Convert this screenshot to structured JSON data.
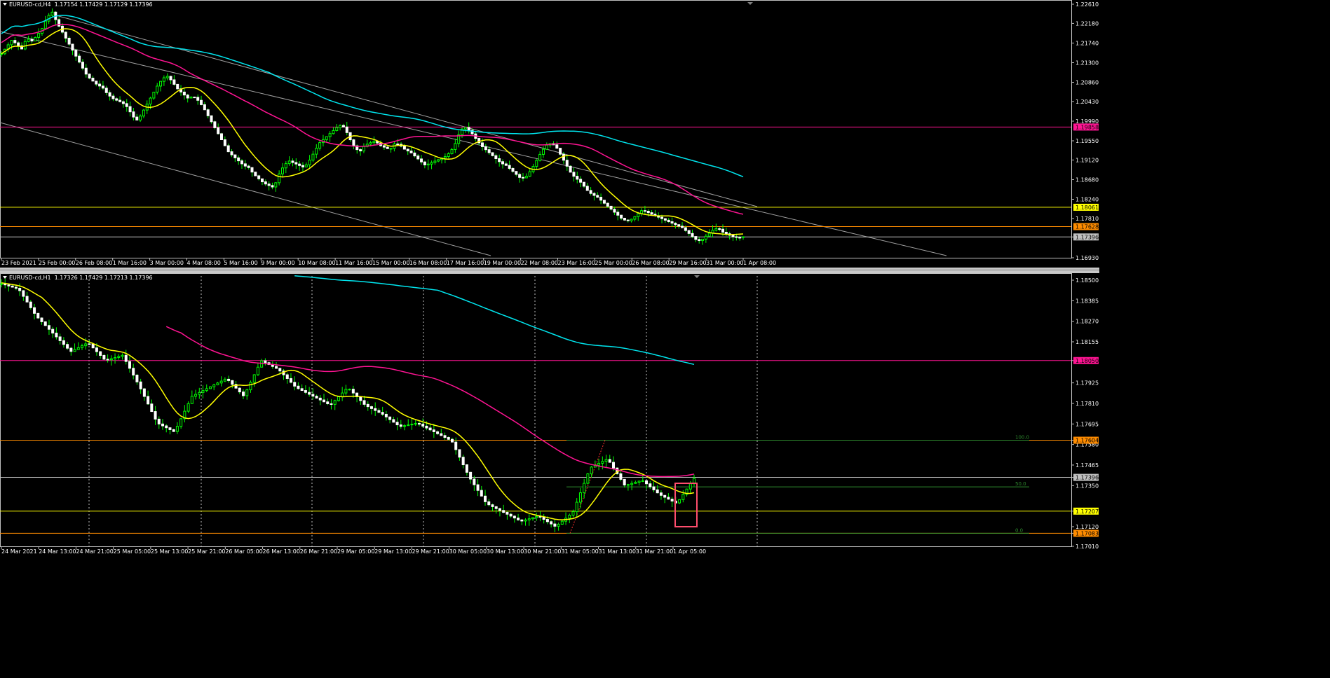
{
  "panes": [
    {
      "id": "h4",
      "title": {
        "symbol": "EURUSD-cd,H4",
        "ohlc": "1.17154 1.17429 1.17129 1.17396"
      },
      "chart_data": {
        "type": "candlestick",
        "timeframe": "H4",
        "ylim": [
          1.1693,
          1.2261
        ],
        "y_ticks": [
          "1.22610",
          "1.22180",
          "1.21740",
          "1.21300",
          "1.20860",
          "1.20430",
          "1.19990",
          "1.19550",
          "1.19120",
          "1.18680",
          "1.18240",
          "1.17810",
          "1.17396",
          "1.16930"
        ],
        "x_labels": [
          "23 Feb 2021",
          "25 Feb 00:00",
          "26 Feb 08:00",
          "1 Mar 16:00",
          "3 Mar 00:00",
          "4 Mar 08:00",
          "5 Mar 16:00",
          "9 Mar 00:00",
          "10 Mar 08:00",
          "11 Mar 16:00",
          "15 Mar 00:00",
          "16 Mar 08:00",
          "17 Mar 16:00",
          "19 Mar 00:00",
          "22 Mar 08:00",
          "23 Mar 16:00",
          "25 Mar 00:00",
          "26 Mar 08:00",
          "29 Mar 16:00",
          "31 Mar 00:00",
          "1 Apr 08:00"
        ],
        "n_bars": 220,
        "closes": [
          1.215,
          1.2165,
          1.218,
          1.2172,
          1.216,
          1.2185,
          1.2178,
          1.219,
          1.2205,
          1.223,
          1.2245,
          1.222,
          1.22,
          1.218,
          1.216,
          1.214,
          1.212,
          1.21,
          1.209,
          1.208,
          1.2075,
          1.206,
          1.205,
          1.2045,
          1.204,
          1.203,
          1.201,
          1.2,
          1.202,
          1.204,
          1.206,
          1.208,
          1.2095,
          1.21,
          1.2085,
          1.207,
          1.206,
          1.205,
          1.2055,
          1.2045,
          1.203,
          1.201,
          1.199,
          1.197,
          1.195,
          1.193,
          1.192,
          1.191,
          1.19,
          1.1895,
          1.188,
          1.187,
          1.186,
          1.1855,
          1.185,
          1.188,
          1.19,
          1.191,
          1.1905,
          1.19,
          1.1895,
          1.191,
          1.193,
          1.195,
          1.196,
          1.197,
          1.198,
          1.199,
          1.1985,
          1.196,
          1.194,
          1.193,
          1.1945,
          1.195,
          1.1955,
          1.1945,
          1.194,
          1.1935,
          1.195,
          1.1945,
          1.1935,
          1.193,
          1.192,
          1.191,
          1.19,
          1.1905,
          1.191,
          1.1915,
          1.192,
          1.193,
          1.195,
          1.198,
          1.1985,
          1.1975,
          1.196,
          1.1945,
          1.1935,
          1.1925,
          1.1915,
          1.1905,
          1.19,
          1.189,
          1.188,
          1.187,
          1.1875,
          1.189,
          1.191,
          1.193,
          1.1945,
          1.195,
          1.194,
          1.192,
          1.19,
          1.188,
          1.187,
          1.186,
          1.1845,
          1.1835,
          1.183,
          1.182,
          1.181,
          1.18,
          1.179,
          1.178,
          1.1775,
          1.178,
          1.179,
          1.18,
          1.1795,
          1.179,
          1.1785,
          1.178,
          1.1775,
          1.177,
          1.1765,
          1.176,
          1.175,
          1.174,
          1.173,
          1.1735,
          1.1745,
          1.1755,
          1.176,
          1.175,
          1.1745,
          1.174,
          1.1738,
          1.174
        ],
        "series": [
          {
            "name": "MA fast",
            "color": "#ffff00"
          },
          {
            "name": "MA mid",
            "color": "#ff1493"
          },
          {
            "name": "MA slow",
            "color": "#00e5ee"
          }
        ],
        "h_lines": [
          {
            "price": 1.19858,
            "color": "#ff1493",
            "label": "1.19858"
          },
          {
            "price": 1.18061,
            "color": "#ffff00",
            "label": "1.18061"
          },
          {
            "price": 1.17628,
            "color": "#ff8c00",
            "label": "1.17628"
          },
          {
            "price": 1.17396,
            "color": "#c0c0c0",
            "label": "1.17396"
          }
        ],
        "bid_label": "1.17396"
      }
    },
    {
      "id": "h1",
      "title": {
        "symbol": "EURUSD-cd,H1",
        "ohlc": "1.17326 1.17429 1.17213 1.17396"
      },
      "chart_data": {
        "type": "candlestick",
        "timeframe": "H1",
        "ylim": [
          1.1701,
          1.185
        ],
        "y_ticks": [
          "1.18500",
          "1.18385",
          "1.18270",
          "1.18155",
          "1.18050",
          "1.17925",
          "1.17810",
          "1.17695",
          "1.17604",
          "1.17580",
          "1.17465",
          "1.17396",
          "1.17350",
          "1.17207",
          "1.17120",
          "1.17083",
          "1.17010"
        ],
        "x_labels": [
          "24 Mar 2021",
          "24 Mar 13:00",
          "24 Mar 21:00",
          "25 Mar 05:00",
          "25 Mar 13:00",
          "25 Mar 21:00",
          "26 Mar 05:00",
          "26 Mar 13:00",
          "26 Mar 21:00",
          "29 Mar 05:00",
          "29 Mar 13:00",
          "29 Mar 21:00",
          "30 Mar 05:00",
          "30 Mar 13:00",
          "30 Mar 21:00",
          "31 Mar 05:00",
          "31 Mar 13:00",
          "31 Mar 21:00",
          "1 Apr 05:00"
        ],
        "n_bars": 190,
        "series": [
          {
            "name": "MA fast",
            "color": "#ffff00"
          },
          {
            "name": "MA mid",
            "color": "#ff1493"
          },
          {
            "name": "MA slow",
            "color": "#00e5ee"
          }
        ],
        "h_lines": [
          {
            "price": 1.1805,
            "color": "#ff1493",
            "label": "1.18050"
          },
          {
            "price": 1.17604,
            "color": "#ff8c00",
            "label": "1.17604"
          },
          {
            "price": 1.17396,
            "color": "#c0c0c0",
            "label": "1.17396"
          },
          {
            "price": 1.17207,
            "color": "#ffff00",
            "label": "1.17207"
          },
          {
            "price": 1.17083,
            "color": "#ff8c00",
            "label": "1.17083"
          }
        ],
        "fibo": [
          {
            "level": "100.0",
            "price": 1.17604
          },
          {
            "level": "50.0",
            "price": 1.17343
          },
          {
            "level": "0.0",
            "price": 1.17083
          }
        ],
        "bid_label": "1.17396"
      }
    }
  ]
}
